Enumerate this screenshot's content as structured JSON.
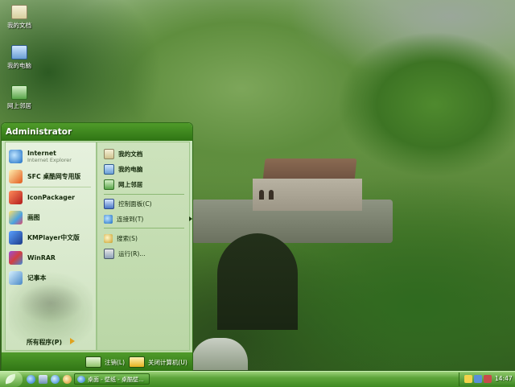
{
  "desktop": {
    "icons": [
      {
        "label": "我的文档",
        "icon": "my-documents-icon"
      },
      {
        "label": "我的电脑",
        "icon": "my-computer-icon"
      },
      {
        "label": "网上邻居",
        "icon": "network-places-icon"
      }
    ]
  },
  "start_menu": {
    "user": "Administrator",
    "pinned": [
      {
        "label": "Internet",
        "sub": "Internet Explorer",
        "icon": "internet-explorer-icon"
      },
      {
        "label": "SFC 桌酷网专用版",
        "icon": "sfc-icon"
      }
    ],
    "programs": [
      {
        "label": "IconPackager",
        "icon": "iconpackager-icon"
      },
      {
        "label": "画图",
        "icon": "paint-icon"
      },
      {
        "label": "KMPlayer中文版",
        "icon": "kmplayer-icon"
      },
      {
        "label": "WinRAR",
        "icon": "winrar-icon"
      },
      {
        "label": "记事本",
        "icon": "notepad-icon"
      }
    ],
    "all_programs": "所有程序(P)",
    "right": {
      "my_documents": "我的文档",
      "my_computer": "我的电脑",
      "network": "网上邻居",
      "control_panel": "控制面板(C)",
      "connect_to": "连接到(T)",
      "search": "搜索(S)",
      "run": "运行(R)..."
    },
    "footer": {
      "logoff": "注销(L)",
      "shutdown": "关闭计算机(U)"
    }
  },
  "taskbar": {
    "task": "桌面 - 壁纸 - 桌酷壁...",
    "clock": "14:47"
  },
  "colors": {
    "menu_header": "#3f8a1f",
    "taskbar": "#4f9b2a"
  }
}
